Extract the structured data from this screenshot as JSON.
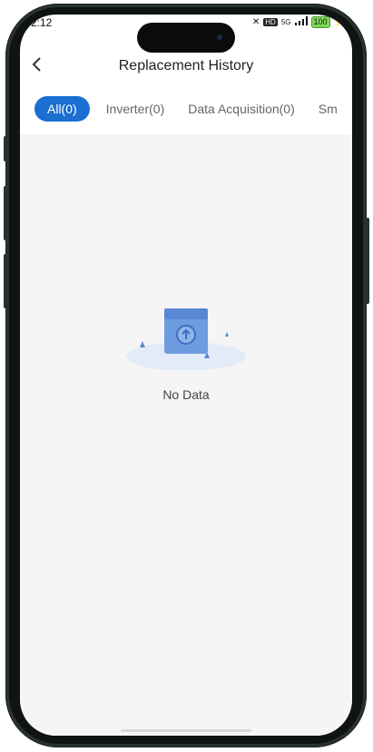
{
  "status_bar": {
    "time": "2:12",
    "network": "5G",
    "battery": "100"
  },
  "header": {
    "title": "Replacement History"
  },
  "tabs": [
    {
      "label": "All(0)",
      "active": true
    },
    {
      "label": "Inverter(0)",
      "active": false
    },
    {
      "label": "Data Acquisition(0)",
      "active": false
    },
    {
      "label": "Sm",
      "active": false
    }
  ],
  "empty_state": {
    "icon": "empty-box-icon",
    "message": "No Data"
  },
  "colors": {
    "accent": "#1a6fd0",
    "content_bg": "#f5f5f5"
  }
}
